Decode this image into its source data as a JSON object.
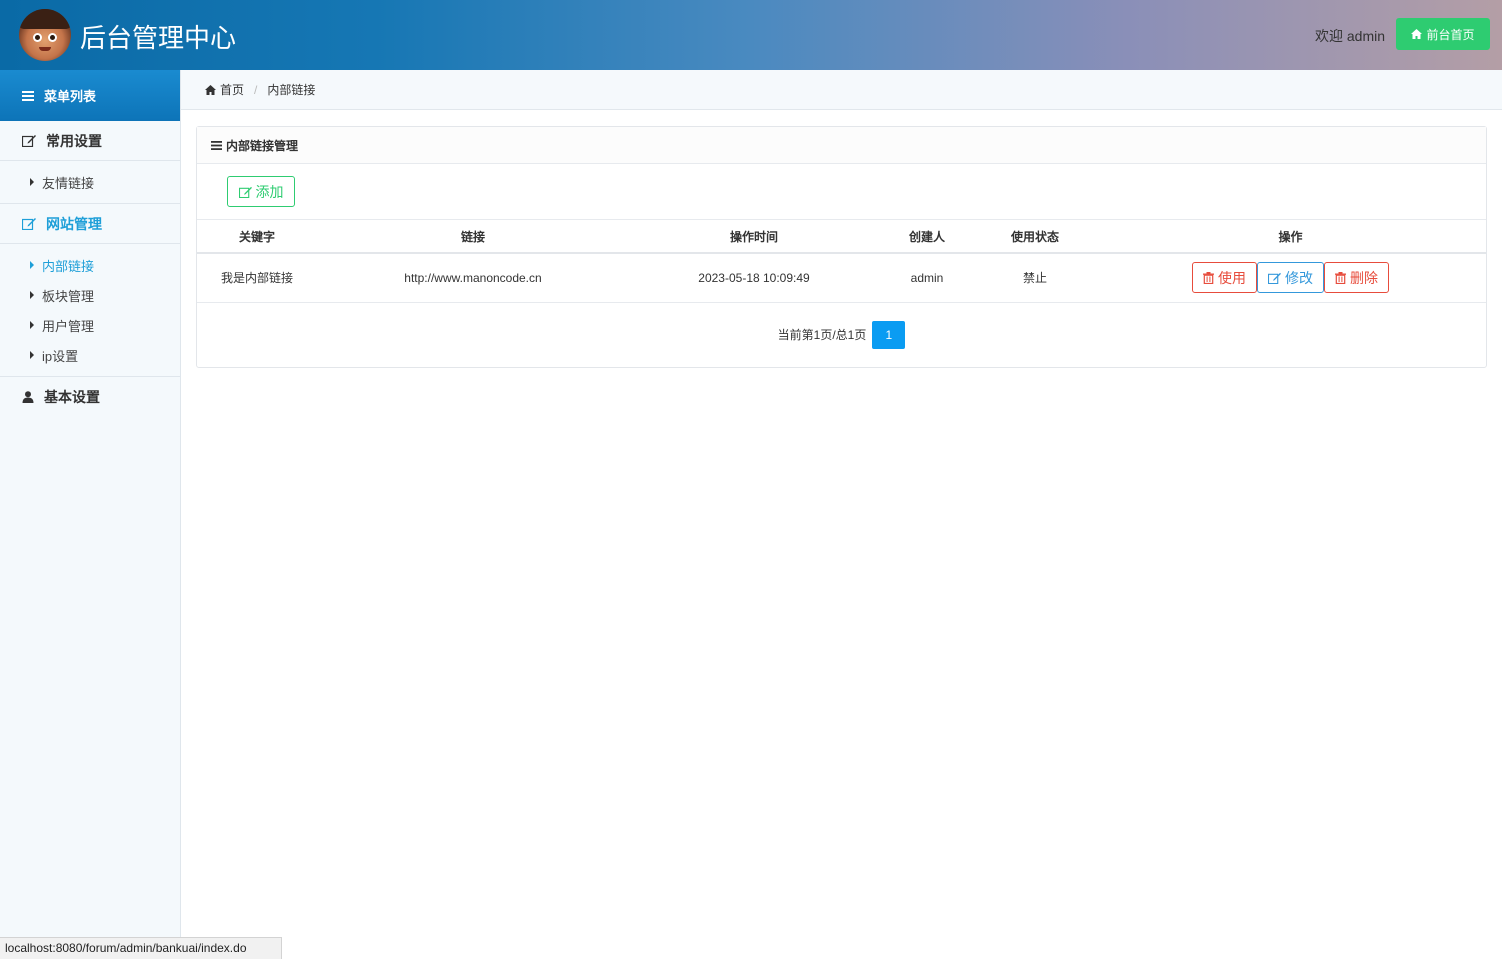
{
  "header": {
    "title": "后台管理中心",
    "welcome": "欢迎 admin",
    "front_button": "前台首页"
  },
  "sidebar": {
    "menu_title": "菜单列表",
    "groups": [
      {
        "label": "常用设置",
        "items": [
          {
            "label": "友情链接"
          }
        ]
      },
      {
        "label": "网站管理",
        "items": [
          {
            "label": "内部链接"
          },
          {
            "label": "板块管理"
          },
          {
            "label": "用户管理"
          },
          {
            "label": "ip设置"
          }
        ]
      },
      {
        "label": "基本设置",
        "items": []
      }
    ]
  },
  "breadcrumb": {
    "home": "首页",
    "current": "内部链接"
  },
  "panel": {
    "title": "内部链接管理",
    "add_button": "添加",
    "columns": [
      "关键字",
      "链接",
      "操作时间",
      "创建人",
      "使用状态",
      "操作"
    ],
    "rows": [
      {
        "keyword": "我是内部链接",
        "link": "http://www.manoncode.cn",
        "time": "2023-05-18 10:09:49",
        "creator": "admin",
        "status": "禁止",
        "actions": {
          "use": "使用",
          "edit": "修改",
          "delete": "删除"
        }
      }
    ],
    "pager": {
      "info": "当前第1页/总1页",
      "current_page": "1"
    }
  },
  "statusbar": {
    "url": "localhost:8080/forum/admin/bankuai/index.do"
  },
  "colors": {
    "accent": "#1e9fd8",
    "success": "#2ecc71",
    "danger": "#e74c3c",
    "primary": "#3498db"
  }
}
